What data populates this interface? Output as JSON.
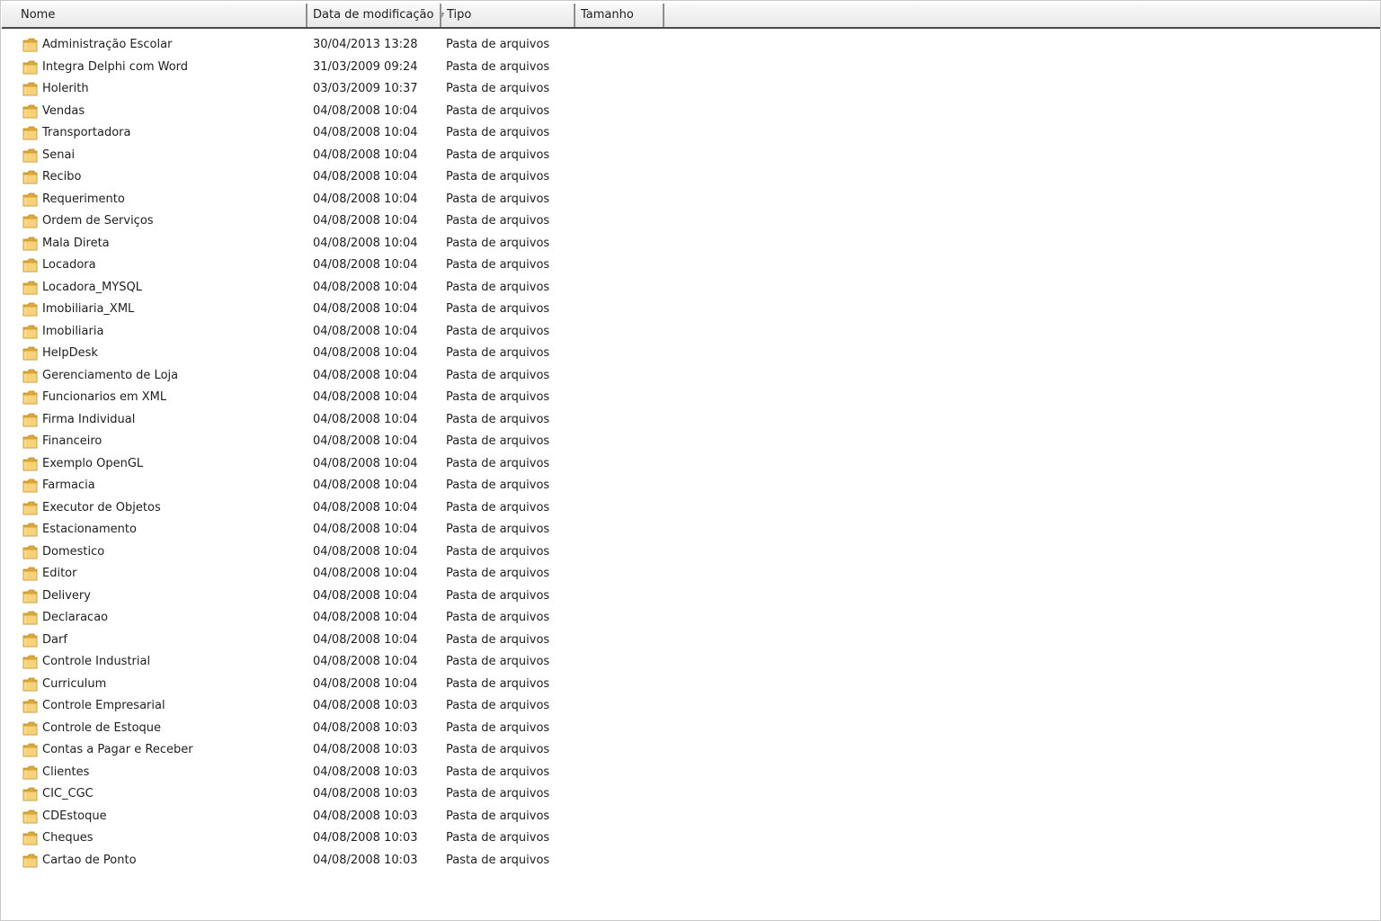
{
  "columns": {
    "name": "Nome",
    "date": "Data de modificação",
    "type": "Tipo",
    "size": "Tamanho"
  },
  "icons": {
    "folder": "folder-icon",
    "sort": "sort-arrow-icon"
  },
  "colors": {
    "header_bg": "#f0f0f0",
    "folder_yellow": "#f2c75a",
    "text": "#1e1e1e"
  },
  "files": [
    {
      "name": "Administração Escolar",
      "date": "30/04/2013 13:28",
      "type": "Pasta de arquivos"
    },
    {
      "name": "Integra Delphi com Word",
      "date": "31/03/2009 09:24",
      "type": "Pasta de arquivos"
    },
    {
      "name": "Holerith",
      "date": "03/03/2009 10:37",
      "type": "Pasta de arquivos"
    },
    {
      "name": "Vendas",
      "date": "04/08/2008 10:04",
      "type": "Pasta de arquivos"
    },
    {
      "name": "Transportadora",
      "date": "04/08/2008 10:04",
      "type": "Pasta de arquivos"
    },
    {
      "name": "Senai",
      "date": "04/08/2008 10:04",
      "type": "Pasta de arquivos"
    },
    {
      "name": "Recibo",
      "date": "04/08/2008 10:04",
      "type": "Pasta de arquivos"
    },
    {
      "name": "Requerimento",
      "date": "04/08/2008 10:04",
      "type": "Pasta de arquivos"
    },
    {
      "name": "Ordem de Serviços",
      "date": "04/08/2008 10:04",
      "type": "Pasta de arquivos"
    },
    {
      "name": "Mala Direta",
      "date": "04/08/2008 10:04",
      "type": "Pasta de arquivos"
    },
    {
      "name": "Locadora",
      "date": "04/08/2008 10:04",
      "type": "Pasta de arquivos"
    },
    {
      "name": "Locadora_MYSQL",
      "date": "04/08/2008 10:04",
      "type": "Pasta de arquivos"
    },
    {
      "name": "Imobiliaria_XML",
      "date": "04/08/2008 10:04",
      "type": "Pasta de arquivos"
    },
    {
      "name": "Imobiliaria",
      "date": "04/08/2008 10:04",
      "type": "Pasta de arquivos"
    },
    {
      "name": "HelpDesk",
      "date": "04/08/2008 10:04",
      "type": "Pasta de arquivos"
    },
    {
      "name": "Gerenciamento de Loja",
      "date": "04/08/2008 10:04",
      "type": "Pasta de arquivos"
    },
    {
      "name": "Funcionarios em XML",
      "date": "04/08/2008 10:04",
      "type": "Pasta de arquivos"
    },
    {
      "name": "Firma Individual",
      "date": "04/08/2008 10:04",
      "type": "Pasta de arquivos"
    },
    {
      "name": "Financeiro",
      "date": "04/08/2008 10:04",
      "type": "Pasta de arquivos"
    },
    {
      "name": "Exemplo OpenGL",
      "date": "04/08/2008 10:04",
      "type": "Pasta de arquivos"
    },
    {
      "name": "Farmacia",
      "date": "04/08/2008 10:04",
      "type": "Pasta de arquivos"
    },
    {
      "name": "Executor de Objetos",
      "date": "04/08/2008 10:04",
      "type": "Pasta de arquivos"
    },
    {
      "name": "Estacionamento",
      "date": "04/08/2008 10:04",
      "type": "Pasta de arquivos"
    },
    {
      "name": "Domestico",
      "date": "04/08/2008 10:04",
      "type": "Pasta de arquivos"
    },
    {
      "name": "Editor",
      "date": "04/08/2008 10:04",
      "type": "Pasta de arquivos"
    },
    {
      "name": "Delivery",
      "date": "04/08/2008 10:04",
      "type": "Pasta de arquivos"
    },
    {
      "name": "Declaracao",
      "date": "04/08/2008 10:04",
      "type": "Pasta de arquivos"
    },
    {
      "name": "Darf",
      "date": "04/08/2008 10:04",
      "type": "Pasta de arquivos"
    },
    {
      "name": "Controle Industrial",
      "date": "04/08/2008 10:04",
      "type": "Pasta de arquivos"
    },
    {
      "name": "Curriculum",
      "date": "04/08/2008 10:04",
      "type": "Pasta de arquivos"
    },
    {
      "name": "Controle Empresarial",
      "date": "04/08/2008 10:03",
      "type": "Pasta de arquivos"
    },
    {
      "name": "Controle de Estoque",
      "date": "04/08/2008 10:03",
      "type": "Pasta de arquivos"
    },
    {
      "name": "Contas a Pagar e Receber",
      "date": "04/08/2008 10:03",
      "type": "Pasta de arquivos"
    },
    {
      "name": "Clientes",
      "date": "04/08/2008 10:03",
      "type": "Pasta de arquivos"
    },
    {
      "name": "CIC_CGC",
      "date": "04/08/2008 10:03",
      "type": "Pasta de arquivos"
    },
    {
      "name": "CDEstoque",
      "date": "04/08/2008 10:03",
      "type": "Pasta de arquivos"
    },
    {
      "name": "Cheques",
      "date": "04/08/2008 10:03",
      "type": "Pasta de arquivos"
    },
    {
      "name": "Cartao de Ponto",
      "date": "04/08/2008 10:03",
      "type": "Pasta de arquivos"
    }
  ]
}
